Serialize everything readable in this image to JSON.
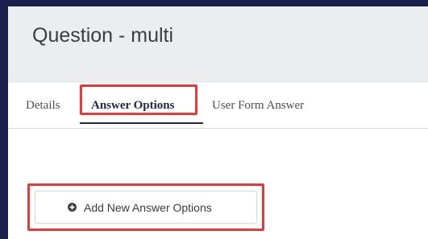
{
  "page": {
    "title": "Question - multi"
  },
  "tabs": [
    {
      "label": "Details",
      "active": false
    },
    {
      "label": "Answer Options",
      "active": true
    },
    {
      "label": "User Form Answer",
      "active": false
    }
  ],
  "actions": {
    "add_label": "Add New Answer Options",
    "add_icon": "plus-circle-icon"
  },
  "colors": {
    "frame": "#1b1f4b",
    "header_bg": "#ecedee",
    "active_tab": "#1d2a4c",
    "highlight": "#e33b3b"
  }
}
